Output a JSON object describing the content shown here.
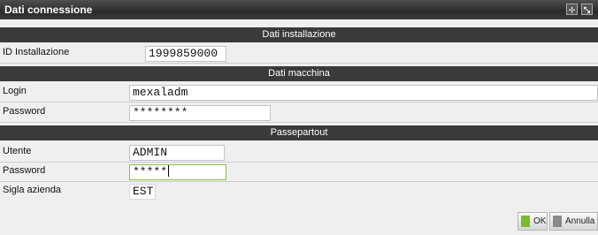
{
  "window": {
    "title": "Dati connessione"
  },
  "titlebar_icons": {
    "left": "expand-icon",
    "right": "restore-icon",
    "left_glyph": "⊹",
    "right_glyph": "⤡"
  },
  "sections": {
    "installazione": "Dati installazione",
    "macchina": "Dati macchina",
    "passepartout": "Passepartout"
  },
  "installazione": {
    "id_label": "ID Installazione",
    "id_value": "1999859000"
  },
  "macchina": {
    "login_label": "Login",
    "login_value": "mexaladm",
    "password_label": "Password",
    "password_value": "********"
  },
  "passepartout": {
    "utente_label": "Utente",
    "utente_value": "ADMIN",
    "password_label": "Password",
    "password_value": "*****",
    "sigla_label": "Sigla azienda",
    "sigla_value": "EST"
  },
  "buttons": {
    "ok": "OK",
    "annulla": "Annulla"
  },
  "colors": {
    "ok_square": "#7dbb2c",
    "annulla_square": "#8a8a8a",
    "section_bg": "#3a3a3a"
  }
}
